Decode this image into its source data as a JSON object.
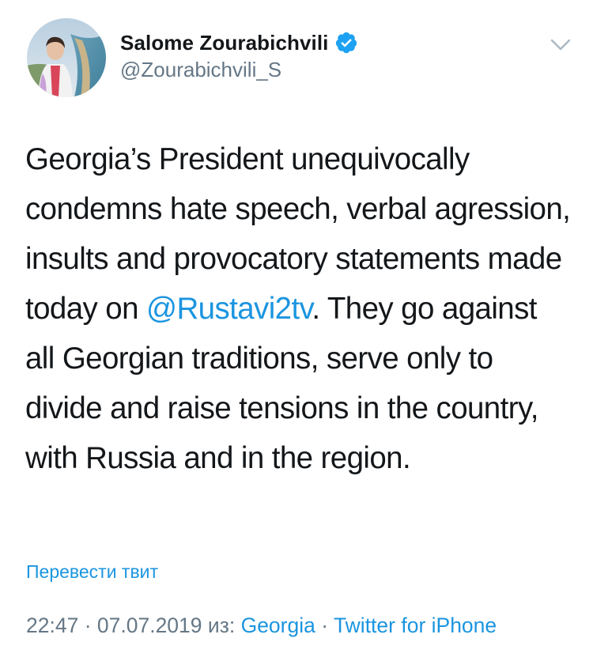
{
  "author": {
    "display_name": "Salome Zourabichvili",
    "handle": "@Zourabichvili_S",
    "verified": true,
    "avatar": "profile-photo"
  },
  "tweet": {
    "text_before_mention": "Georgia’s President unequivocally condemns hate speech, verbal agression, insults and provocatory statements made today on ",
    "mention": "@Rustavi2tv",
    "text_after_mention": ". They go against all Georgian traditions, serve only to divide and raise tensions in the country, with Russia and in the region."
  },
  "translate_link": "Перевести твит",
  "meta": {
    "time": "22:47",
    "sep1": " · ",
    "date": "07.07.2019",
    "from_label": " из: ",
    "location": "Georgia",
    "sep2": " · ",
    "source": "Twitter for iPhone"
  },
  "icons": {
    "verified": "verified-badge-icon",
    "menu": "chevron-down-icon"
  },
  "colors": {
    "link": "#1b95e0",
    "secondary_text": "#657786",
    "primary_text": "#14171a",
    "verified": "#1da1f2"
  }
}
